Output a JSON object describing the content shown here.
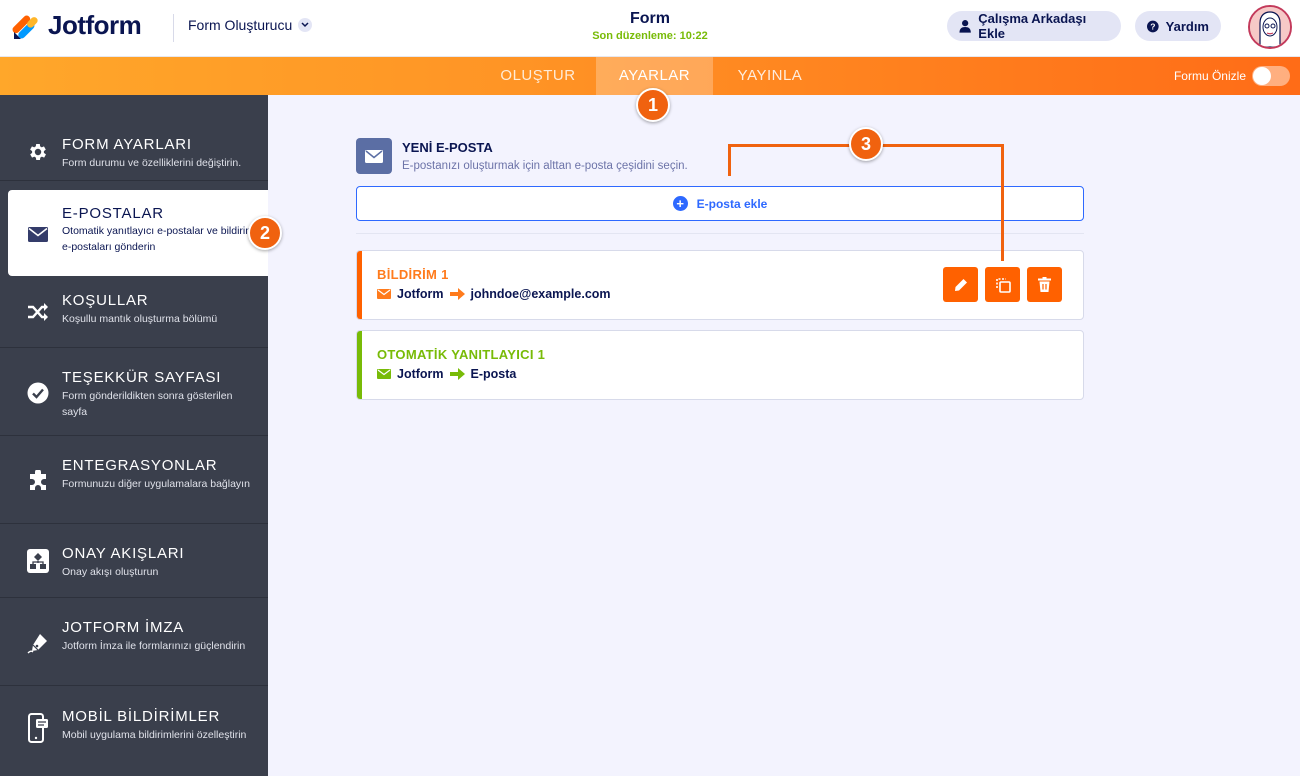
{
  "header": {
    "brand": "Jotform",
    "builder_label": "Form Oluşturucu",
    "form_title": "Form",
    "last_edit": "Son düzenleme: 10:22",
    "collab_label": "Çalışma Arkadaşı Ekle",
    "help_label": "Yardım"
  },
  "nav": {
    "tabs": [
      {
        "label": "OLUŞTUR"
      },
      {
        "label": "AYARLAR"
      },
      {
        "label": "YAYINLA"
      }
    ],
    "preview_label": "Formu Önizle"
  },
  "sidebar": {
    "items": [
      {
        "title": "FORM AYARLARI",
        "desc": "Form durumu ve özelliklerini değiştirin.",
        "icon": "gear-icon"
      },
      {
        "title": "E-POSTALAR",
        "desc": "Otomatik yanıtlayıcı e-postalar ve bildirim e-postaları gönderin",
        "icon": "envelope-icon"
      },
      {
        "title": "KOŞULLAR",
        "desc": "Koşullu mantık oluşturma bölümü",
        "icon": "shuffle-icon"
      },
      {
        "title": "TEŞEKKÜR SAYFASI",
        "desc": "Form gönderildikten sonra gösterilen sayfa",
        "icon": "check-circle-icon"
      },
      {
        "title": "ENTEGRASYONLAR",
        "desc": "Formunuzu diğer uygulamalara bağlayın",
        "icon": "puzzle-icon"
      },
      {
        "title": "ONAY AKIŞLARI",
        "desc": "Onay akışı oluşturun",
        "icon": "flow-icon"
      },
      {
        "title": "JOTFORM İMZA",
        "desc": "Jotform İmza ile formlarınızı güçlendirin",
        "icon": "pen-icon"
      },
      {
        "title": "MOBİL BİLDİRİMLER",
        "desc": "Mobil uygulama bildirimlerini özelleştirin",
        "icon": "mobile-icon"
      }
    ]
  },
  "main": {
    "new_email_title": "YENİ E-POSTA",
    "new_email_desc": "E-postanızı oluşturmak için alttan e-posta çeşidini seçin.",
    "add_email_label": "E-posta ekle",
    "emails": [
      {
        "title": "BİLDİRİM 1",
        "from": "Jotform",
        "to": "johndoe@example.com"
      },
      {
        "title": "OTOMATİK YANITLAYICI 1",
        "from": "Jotform",
        "to": "E-posta"
      }
    ]
  },
  "badges": [
    "1",
    "2",
    "3"
  ],
  "colors": {
    "brand_orange": "#ff6100",
    "sidebar_bg": "#3a3f4c",
    "accent_blue": "#2e69ff",
    "autoresponder_green": "#78bb07",
    "navy": "#0a1551"
  }
}
